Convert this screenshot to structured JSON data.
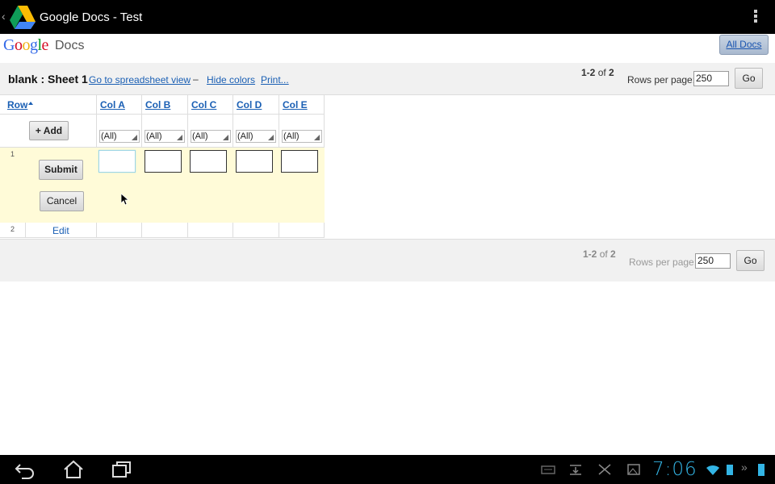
{
  "actionbar": {
    "title": "Google Docs - Test"
  },
  "header": {
    "logo_docs": "Docs",
    "all_docs": "All Docs"
  },
  "toolbar": {
    "sheet_title": "blank : Sheet 1",
    "spreadsheet_view": "Go to spreadsheet view",
    "separator": "–",
    "hide_colors": "Hide colors",
    "print": "Print...",
    "range": "1-2",
    "of_label": "of",
    "total": "2",
    "rows_per_page_label": "Rows per page:",
    "rows_per_page_value": "250",
    "go": "Go"
  },
  "grid": {
    "row_header": "Row",
    "columns": [
      "Col A",
      "Col B",
      "Col C",
      "Col D",
      "Col E"
    ],
    "filter_value": "(All)",
    "add_button": "+ Add",
    "edit_row_number": "1",
    "submit": "Submit",
    "cancel": "Cancel",
    "row2_number": "2",
    "row2_edit": "Edit"
  },
  "footer": {
    "range": "1-2",
    "of_label": "of",
    "total": "2",
    "rows_per_page_label": "Rows per page:",
    "rows_per_page_value": "250",
    "go": "Go"
  },
  "status": {
    "clock": "7:06"
  },
  "colors": {
    "link": "#1a5fb4",
    "edit_row_bg": "#fffbd8",
    "clock": "#33b5e5"
  }
}
